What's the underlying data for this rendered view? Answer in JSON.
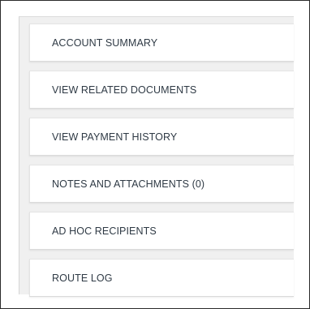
{
  "nav": {
    "items": [
      {
        "label": "ACCOUNT SUMMARY"
      },
      {
        "label": "VIEW RELATED DOCUMENTS"
      },
      {
        "label": "VIEW PAYMENT HISTORY"
      },
      {
        "label": "NOTES AND ATTACHMENTS (0)"
      },
      {
        "label": "AD HOC RECIPIENTS"
      },
      {
        "label": "ROUTE LOG"
      }
    ]
  },
  "colors": {
    "panel_bg": "#f0f0f0",
    "item_bg": "#ffffff",
    "label_text": "#2f3a45",
    "frame_border": "#2b2b2b"
  }
}
